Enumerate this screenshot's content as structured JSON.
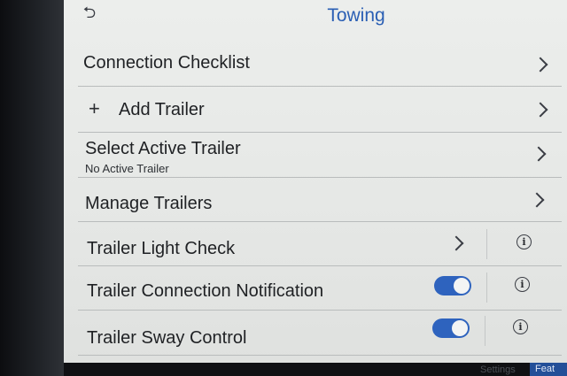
{
  "header": {
    "title": "Towing"
  },
  "rows": [
    {
      "label": "Connection Checklist"
    },
    {
      "label": "Add Trailer"
    },
    {
      "label": "Select Active Trailer",
      "sublabel": "No Active Trailer"
    },
    {
      "label": "Manage Trailers"
    },
    {
      "label": "Trailer Light Check"
    },
    {
      "label": "Trailer Connection Notification",
      "toggle_on": true
    },
    {
      "label": "Trailer Sway Control",
      "toggle_on": true
    }
  ],
  "bottom_tabs": {
    "settings": "Settings",
    "features": "Feat"
  },
  "colors": {
    "accent": "#2e63be",
    "title": "#2a5fb4",
    "background": "#eceeec"
  }
}
